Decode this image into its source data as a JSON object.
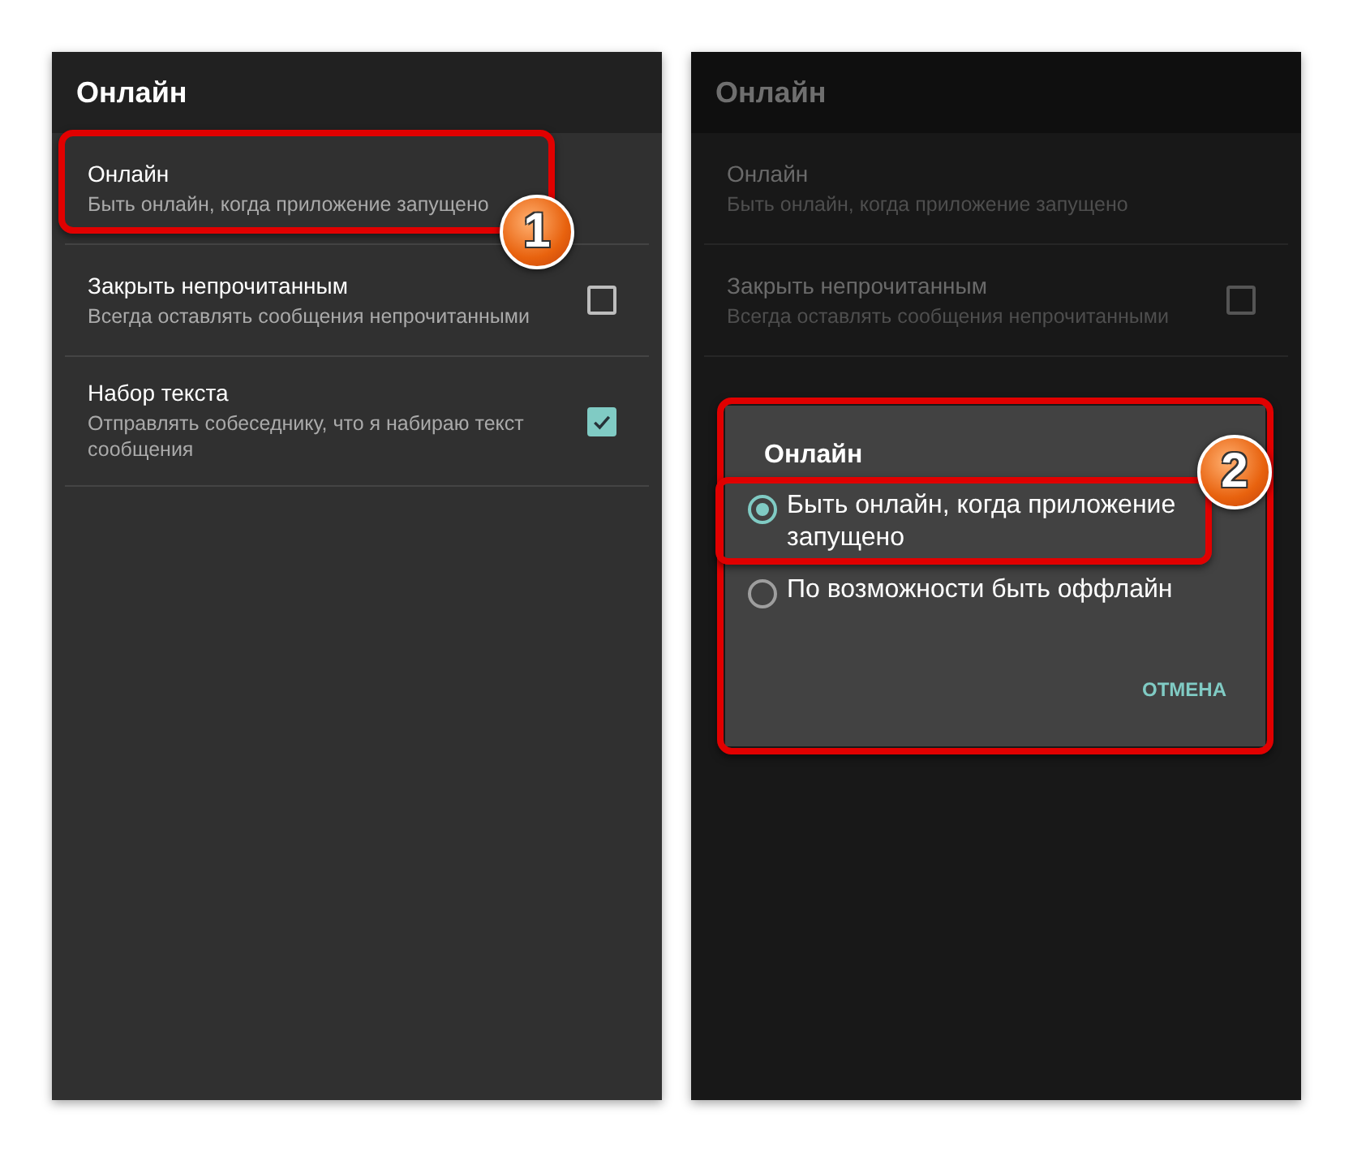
{
  "screens": [
    {
      "dimmed": false,
      "title": "Онлайн",
      "items": [
        {
          "kind": "text",
          "title": "Онлайн",
          "summary": "Быть онлайн, когда приложение запущено",
          "highlighted": true,
          "badge": "1"
        },
        {
          "kind": "checkbox",
          "title": "Закрыть непрочитанным",
          "summary": "Всегда оставлять сообщения непрочитанными",
          "checked": false,
          "highlighted": false
        },
        {
          "kind": "checkbox",
          "title": "Набор текста",
          "summary": "Отправлять собеседнику, что я набираю текст сообщения",
          "checked": true,
          "highlighted": false
        }
      ]
    },
    {
      "dimmed": true,
      "title": "Онлайн",
      "items": [
        {
          "kind": "text",
          "title": "Онлайн",
          "summary": "Быть онлайн, когда приложение запущено",
          "highlighted": false
        },
        {
          "kind": "checkbox",
          "title": "Закрыть непрочитанным",
          "summary": "Всегда оставлять сообщения непрочитанными",
          "checked": false,
          "highlighted": false
        }
      ],
      "dialog": {
        "title": "Онлайн",
        "highlighted": true,
        "options": [
          {
            "label": "Быть онлайн, когда приложение запущено",
            "selected": true,
            "highlighted": true,
            "badge": "2"
          },
          {
            "label": "По возможности быть оффлайн",
            "selected": false,
            "highlighted": false
          }
        ],
        "button": "ОТМЕНА"
      }
    }
  ]
}
